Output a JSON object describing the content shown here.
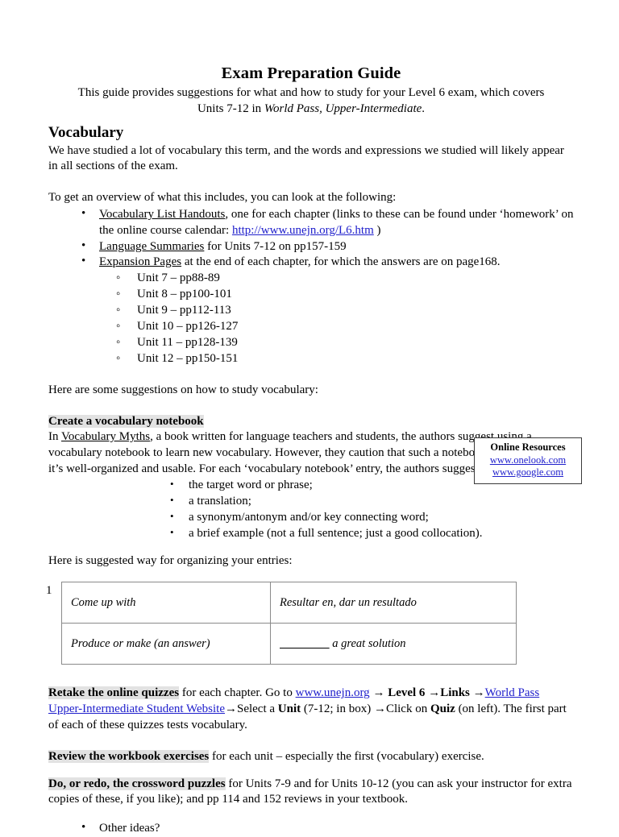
{
  "document": {
    "title": "Exam Preparation Guide",
    "subtitle_line1": "This guide provides suggestions for what and how to study for your Level 6 exam, which covers",
    "subtitle_line2_pre": "Units 7-12 in ",
    "subtitle_line2_italic": "World Pass, Upper-Intermediate",
    "subtitle_line2_post": "."
  },
  "vocabulary": {
    "heading": "Vocabulary",
    "intro": "We have studied a lot of vocabulary this term, and the words and expressions we studied will likely appear in all sections of the exam.",
    "overview_lead": "To get an overview of what this includes, you can look at the following:",
    "resources": [
      {
        "underlined": "Vocabulary List Handouts",
        "text_before_link": ", one for each chapter (links to these can be found under ‘homework’ on the online course calendar:  ",
        "link": "http://www.unejn.org/L6.htm",
        "text_after_link": " )"
      },
      {
        "underlined": "Language Summaries",
        "text_before_link": " for Units 7-12 on pp157-159",
        "link": "",
        "text_after_link": ""
      },
      {
        "underlined": "Expansion Pages",
        "text_before_link": " at the end of each chapter, for which the answers are on page168.",
        "link": "",
        "text_after_link": ""
      }
    ],
    "units": [
      "Unit 7 – pp88-89",
      "Unit 8 – pp100-101",
      "Unit 9 – pp112-113",
      "Unit 10 – pp126-127",
      "Unit 11 – pp128-139",
      "Unit 12 – pp150-151"
    ],
    "suggestions_lead": "Here are some suggestions on how to study vocabulary:"
  },
  "notebook": {
    "heading": "Create a vocabulary notebook",
    "para_pre": "In ",
    "para_book": "Vocabulary Myths",
    "para_post": ", a book written for language teachers and students, the authors suggest using a vocabulary notebook to learn new vocabulary.  However, they caution that such a notebook is only useful if it’s well-organized and usable. For each ‘vocabulary notebook’ entry, the authors suggest including:",
    "items": [
      "the target word or phrase;",
      "a translation;",
      "a synonym/antonym and/or key connecting word;",
      "a brief example (not a full sentence; just a good collocation)."
    ]
  },
  "online_resources": {
    "title": "Online Resources",
    "links": [
      "www.onelook.com",
      "www.google.com"
    ]
  },
  "entries": {
    "lead": "Here is suggested way for organizing your entries:",
    "row_number": "1",
    "rows": [
      {
        "left": "Come up with",
        "right": "Resultar en, dar un resultado",
        "right_blank": "",
        "right_after": ""
      },
      {
        "left": "Produce or make (an answer)",
        "right": "",
        "right_blank": "                 ",
        "right_after": " a great solution"
      }
    ]
  },
  "quizzes": {
    "bold_highlight": "Retake the online quizzes",
    "text1": " for each chapter.  Go to ",
    "link1": "www.unejn.org",
    "arrow": " → ",
    "bold1": "Level 6",
    "arrow2": " →",
    "bold2": "Links",
    "arrow3": " →",
    "link2": "World Pass Upper-Intermediate Student Website",
    "arrow4": "→",
    "text2": "Select a ",
    "bold3": "Unit",
    "text3": " (7-12; in box) →Click on ",
    "bold4": "Quiz",
    "text4": " (on left).  The first part of each of these quizzes tests vocabulary."
  },
  "workbook": {
    "bold_highlight": "Review the workbook exercises",
    "text": " for each unit – especially the first (vocabulary) exercise."
  },
  "crossword": {
    "bold_highlight": "Do, or redo, the crossword puzzles",
    "text": " for Units 7-9 and for Units 10-12 (you can ask your instructor for extra copies of these, if you like);  and pp 114 and 152 reviews in your textbook."
  },
  "other": {
    "item": "Other ideas?"
  }
}
